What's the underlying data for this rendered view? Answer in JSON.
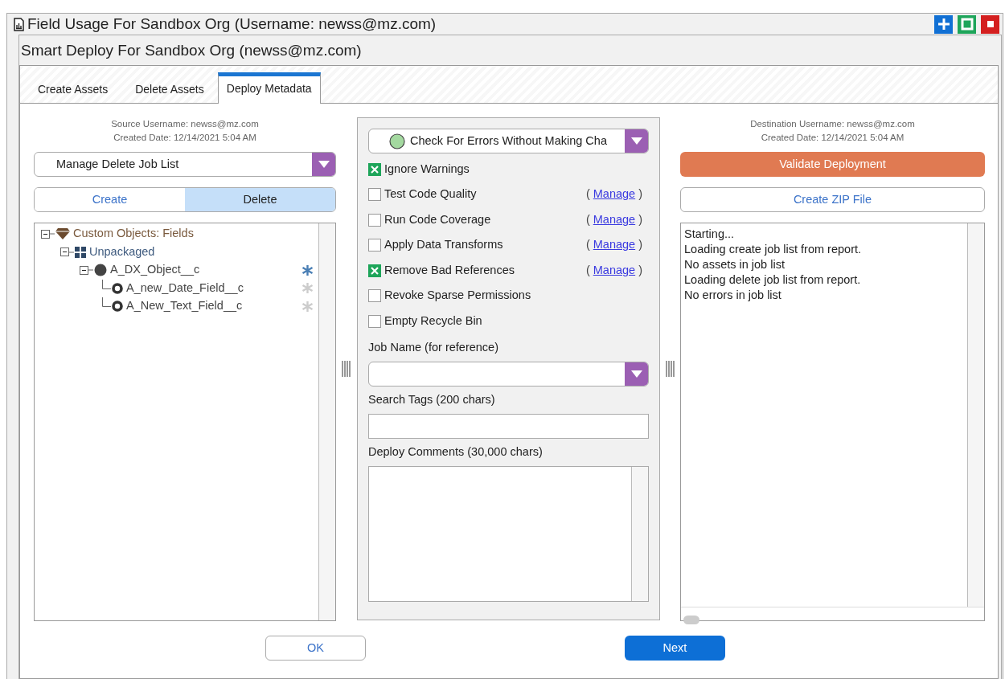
{
  "window": {
    "title": "Field Usage For Sandbox Org (Username: newss@mz.com)"
  },
  "dialog": {
    "title": "Smart Deploy For Sandbox Org (newss@mz.com)"
  },
  "tabs": [
    {
      "label": "Create Assets",
      "selected": false
    },
    {
      "label": "Delete Assets",
      "selected": false
    },
    {
      "label": "Deploy Metadata",
      "selected": true
    }
  ],
  "source": {
    "username": "Source Username: newss@mz.com",
    "created": "Created Date: 12/14/2021 5:04 AM",
    "job_list": "Manage Delete Job List",
    "modes": [
      {
        "label": "Create",
        "selected": false
      },
      {
        "label": "Delete",
        "selected": true
      }
    ],
    "tree": [
      {
        "kind": "category",
        "label": "Custom Objects: Fields",
        "expanded": true,
        "children": [
          {
            "kind": "package",
            "label": "Unpackaged",
            "expanded": true,
            "children": [
              {
                "kind": "object",
                "label": "A_DX_Object__c",
                "expanded": true,
                "starred": true,
                "children": [
                  {
                    "kind": "field",
                    "label": "A_new_Date_Field__c",
                    "starred": false
                  },
                  {
                    "kind": "field",
                    "label": "A_New_Text_Field__c",
                    "starred": false
                  }
                ]
              }
            ]
          }
        ]
      }
    ]
  },
  "options": {
    "mode": "Check For Errors Without Making Cha",
    "checks": [
      {
        "label": "Ignore Warnings",
        "checked": true
      },
      {
        "label": "Test Code Quality",
        "checked": false,
        "link_open": "(",
        "link": "Manage",
        "link_close": ")"
      },
      {
        "label": "Run Code Coverage",
        "checked": false,
        "link_open": "(",
        "link": "Manage",
        "link_close": ")"
      },
      {
        "label": "Apply Data Transforms",
        "checked": false,
        "link_open": "(",
        "link": "Manage",
        "link_close": ")"
      },
      {
        "label": "Remove Bad References",
        "checked": true,
        "link_open": "(",
        "link": "Manage",
        "link_close": ")"
      },
      {
        "label": "Revoke Sparse Permissions",
        "checked": false
      },
      {
        "label": "Empty Recycle Bin",
        "checked": false
      }
    ],
    "job_name_label": "Job Name (for reference)",
    "tags_label": "Search Tags (200 chars)",
    "comments_label": "Deploy Comments (30,000 chars)"
  },
  "destination": {
    "username": "Destination Username: newss@mz.com",
    "created": "Created Date: 12/14/2021 5:04 AM",
    "validate": "Validate Deployment",
    "zip": "Create ZIP File",
    "log": [
      "Starting...",
      "Loading create job list from report.",
      "No assets in job list",
      "Loading delete job list from report.",
      "No errors in job list"
    ]
  },
  "buttons": {
    "ok": "OK",
    "next": "Next"
  }
}
